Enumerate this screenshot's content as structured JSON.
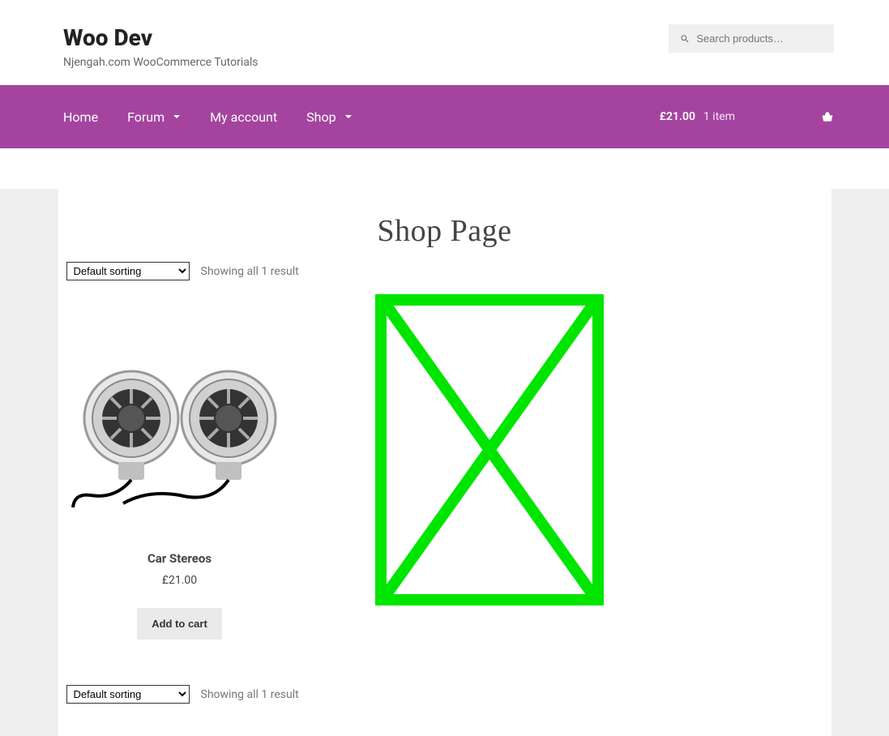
{
  "header": {
    "site_title": "Woo Dev",
    "tagline": "Njengah.com WooCommerce Tutorials",
    "search_placeholder": "Search products…"
  },
  "nav": {
    "items": [
      {
        "label": "Home",
        "has_submenu": false
      },
      {
        "label": "Forum",
        "has_submenu": true
      },
      {
        "label": "My account",
        "has_submenu": false
      },
      {
        "label": "Shop",
        "has_submenu": true
      }
    ],
    "cart": {
      "total": "£21.00",
      "count": "1 item"
    }
  },
  "shop": {
    "page_title": "Shop Page",
    "sort_options": [
      "Default sorting"
    ],
    "sort_selected": "Default sorting",
    "result_count": "Showing all 1 result",
    "products": [
      {
        "name": "Car Stereos",
        "price": "£21.00",
        "add_label": "Add to cart"
      }
    ]
  }
}
